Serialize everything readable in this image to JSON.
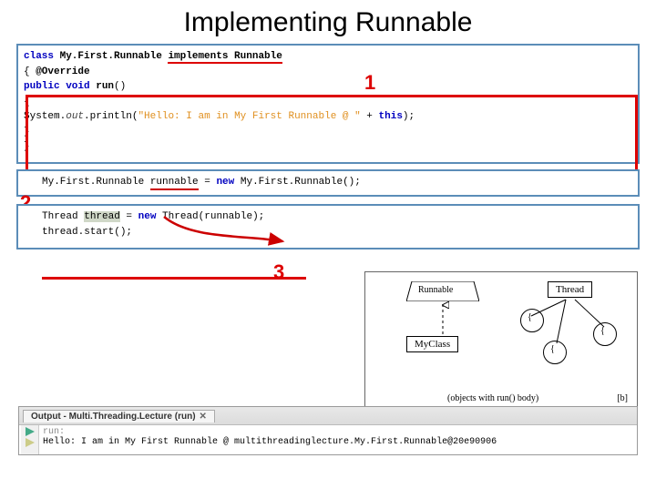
{
  "title": "Implementing Runnable",
  "callouts": {
    "one": "1",
    "two": "2",
    "three": "3"
  },
  "code1": {
    "l1a": "class ",
    "l1b": "My.First.Runnable",
    "l1c": " ",
    "l1d": "implements Runnable",
    "l2a": "{ ",
    "l2b": "@Override",
    "l3a": "  public void ",
    "l3b": "run",
    "l3c": "()",
    "l4": "  {",
    "l5a": "    System.",
    "l5b": "out",
    "l5c": ".println(",
    "l5d": "\"Hello: I am in My First Runnable @ \"",
    "l5e": " + ",
    "l5f": "this",
    "l5g": ");",
    "l6": "  }",
    "l7": "}"
  },
  "code2": {
    "l1a": "My.First.Runnable ",
    "l1b": "runnable",
    "l1c": " = ",
    "l1d": "new",
    "l1e": " My.First.Runnable();"
  },
  "code3": {
    "l1a": "Thread ",
    "l1b": "thread",
    "l1c": " = ",
    "l1d": "new",
    "l1e": " Thread(runnable);",
    "l2": "thread.start();"
  },
  "diagram": {
    "runnable": "Runnable",
    "thread": "Thread",
    "myclass": "MyClass",
    "caption": "(objects with run() body)",
    "panel_label": "[b]"
  },
  "output": {
    "tab_title": "Output - Multi.Threading.Lecture (run)",
    "run_label": "run:",
    "line1": "Hello: I am in My First Runnable @ multithreadinglecture.My.First.Runnable@20e90906"
  }
}
